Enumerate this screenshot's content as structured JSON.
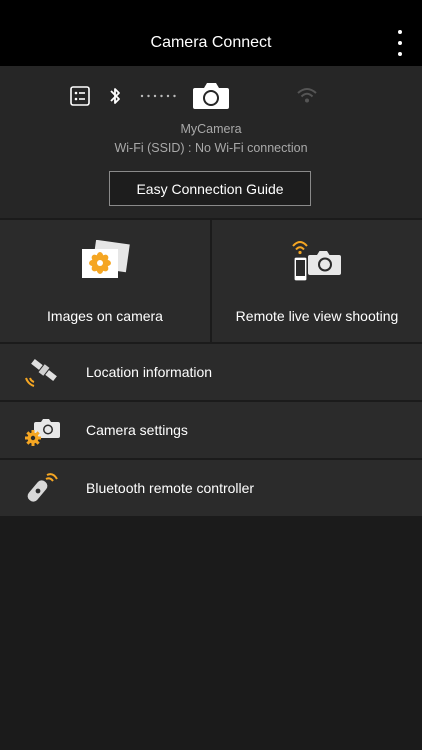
{
  "header": {
    "title": "Camera Connect"
  },
  "status": {
    "camera_name": "MyCamera",
    "ssid_text": "Wi-Fi (SSID) : No Wi-Fi connection",
    "guide_button_label": "Easy Connection Guide"
  },
  "tiles": [
    {
      "label": "Images on camera",
      "icon": "images-icon"
    },
    {
      "label": "Remote live view shooting",
      "icon": "remote-shooting-icon"
    }
  ],
  "menu": [
    {
      "label": "Location information",
      "icon": "gps-satellite-icon"
    },
    {
      "label": "Camera settings",
      "icon": "camera-settings-icon"
    },
    {
      "label": "Bluetooth remote controller",
      "icon": "bluetooth-remote-icon"
    }
  ],
  "colors": {
    "accent": "#f5a623",
    "background": "#1b1b1b",
    "header": "#000000",
    "tile": "#2b2b2b"
  }
}
